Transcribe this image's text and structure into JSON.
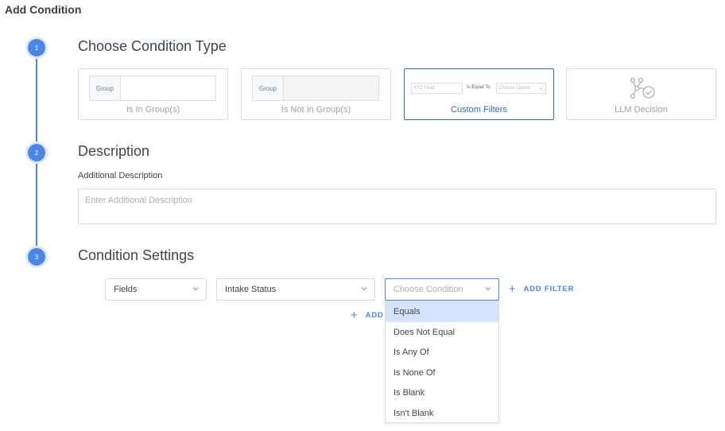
{
  "page": {
    "title": "Add Condition"
  },
  "steps": [
    {
      "number": "1",
      "title": "Choose Condition Type"
    },
    {
      "number": "2",
      "title": "Description"
    },
    {
      "number": "3",
      "title": "Condition Settings"
    }
  ],
  "condition_types": [
    {
      "label": "Is In Group(s)",
      "mini_tag": "Group"
    },
    {
      "label": "Is Not In Group(s)",
      "mini_tag": "Group"
    },
    {
      "label": "Custom Filters",
      "mini_field": "XYZ Field",
      "mini_equal": "Is Equal To",
      "mini_select": "Choose Option",
      "selected": true
    },
    {
      "label": "LLM Decision",
      "icon": "llm-network-icon"
    }
  ],
  "description": {
    "label": "Additional Description",
    "placeholder": "Enter Additional Description"
  },
  "settings": {
    "field_type": "Fields",
    "field_value": "Intake Status",
    "condition_placeholder": "Choose Condition",
    "add_filter_label": "ADD FILTER",
    "add_label": "ADD"
  },
  "dropdown": {
    "options": [
      "Equals",
      "Does Not Equal",
      "Is Any Of",
      "Is None Of",
      "Is Blank",
      "Isn't Blank"
    ],
    "highlighted": "Equals"
  },
  "colors": {
    "accent": "#4a86e8",
    "selected_border": "#2f6bbf",
    "highlight": "#d6e4fb"
  }
}
